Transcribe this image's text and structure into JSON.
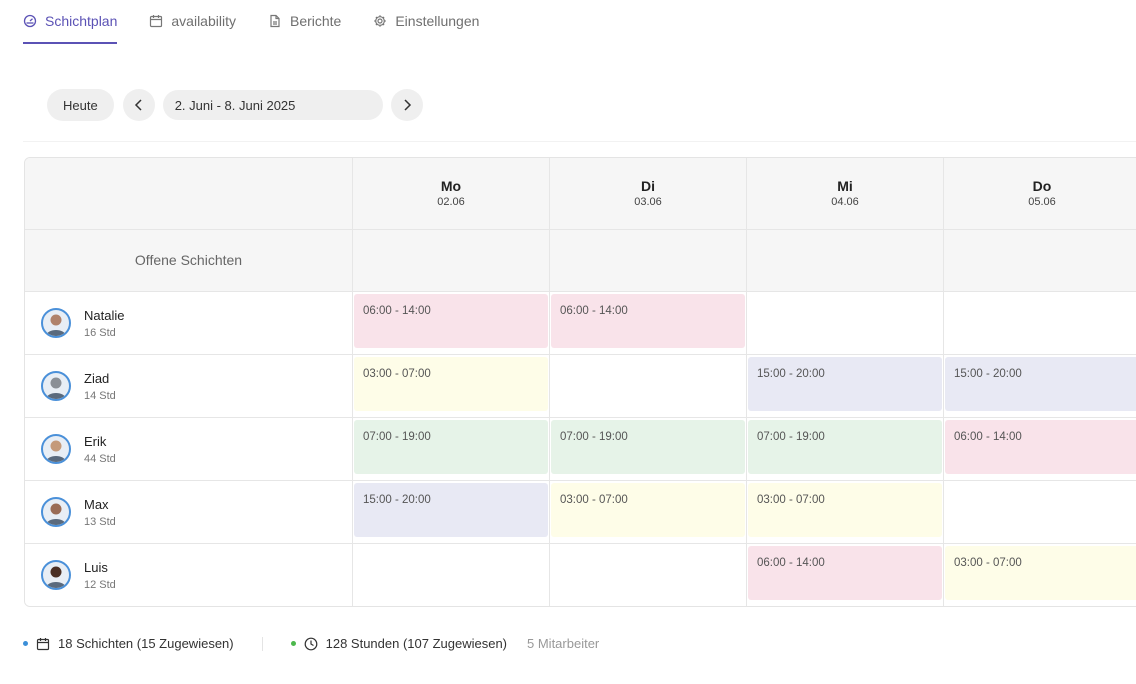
{
  "tabs": [
    {
      "label": "Schichtplan",
      "icon": "gauge-icon",
      "active": true
    },
    {
      "label": "availability",
      "icon": "calendar-icon",
      "active": false
    },
    {
      "label": "Berichte",
      "icon": "document-icon",
      "active": false
    },
    {
      "label": "Einstellungen",
      "icon": "gear-icon",
      "active": false
    }
  ],
  "toolbar": {
    "today_label": "Heute",
    "date_range": "2. Juni - 8. Juni 2025"
  },
  "schedule": {
    "days": [
      {
        "name": "Mo",
        "date": "02.06"
      },
      {
        "name": "Di",
        "date": "03.06"
      },
      {
        "name": "Mi",
        "date": "04.06"
      },
      {
        "name": "Do",
        "date": "05.06"
      }
    ],
    "open_shifts_label": "Offene Schichten",
    "employees": [
      {
        "name": "Natalie",
        "hours": "16 Std",
        "shifts": [
          {
            "time": "06:00 - 14:00",
            "color": "pink"
          },
          {
            "time": "06:00 - 14:00",
            "color": "pink"
          },
          null,
          null
        ]
      },
      {
        "name": "Ziad",
        "hours": "14 Std",
        "shifts": [
          {
            "time": "03:00 - 07:00",
            "color": "yellow"
          },
          null,
          {
            "time": "15:00 - 20:00",
            "color": "blue"
          },
          {
            "time": "15:00 - 20:00",
            "color": "blue"
          }
        ]
      },
      {
        "name": "Erik",
        "hours": "44 Std",
        "shifts": [
          {
            "time": "07:00 - 19:00",
            "color": "green"
          },
          {
            "time": "07:00 - 19:00",
            "color": "green"
          },
          {
            "time": "07:00 - 19:00",
            "color": "green"
          },
          {
            "time": "06:00 - 14:00",
            "color": "pink"
          }
        ]
      },
      {
        "name": "Max",
        "hours": "13 Std",
        "shifts": [
          {
            "time": "15:00 - 20:00",
            "color": "blue"
          },
          {
            "time": "03:00 - 07:00",
            "color": "yellow"
          },
          {
            "time": "03:00 - 07:00",
            "color": "yellow"
          },
          null
        ]
      },
      {
        "name": "Luis",
        "hours": "12 Std",
        "shifts": [
          null,
          null,
          {
            "time": "06:00 - 14:00",
            "color": "pink"
          },
          {
            "time": "03:00 - 07:00",
            "color": "yellow"
          }
        ]
      }
    ],
    "shift_colors": {
      "pink": "#f9e3ea",
      "yellow": "#fefde8",
      "blue": "#e8e9f4",
      "green": "#e6f3e8"
    }
  },
  "footer": {
    "shifts_text": "18 Schichten (15 Zugewiesen)",
    "shifts_dot_color": "#3b8fd8",
    "hours_text": "128 Stunden (107 Zugewiesen)",
    "hours_dot_color": "#4cb84c",
    "employees_text": "5 Mitarbeiter"
  }
}
